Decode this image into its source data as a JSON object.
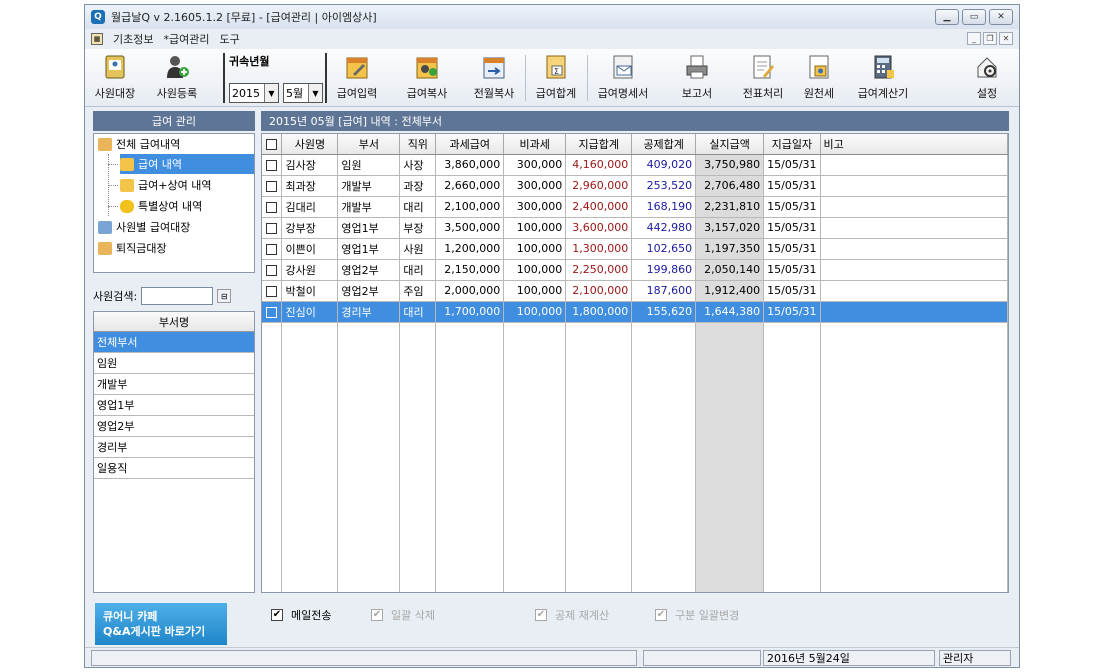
{
  "window": {
    "title": "월급날Q  v 2.1605.1.2 [무료] - [급여관리 | 아이엠상사]",
    "app_icon": "Q"
  },
  "menu": {
    "items": [
      "기초정보",
      "*급여관리",
      "도구"
    ]
  },
  "toolbar": {
    "employee_ledger": "사원대장",
    "employee_register": "사원등록",
    "period_label": "귀속년월",
    "year": "2015",
    "month": "5월",
    "payroll_input": "급여입력",
    "payroll_copy": "급여복사",
    "prev_month_copy": "전월복사",
    "payroll_total": "급여합계",
    "payslip": "급여명세서",
    "report": "보고서",
    "voucher": "전표처리",
    "withholding": "원천세",
    "calculator": "급여계산기",
    "settings": "설정"
  },
  "left_panel": {
    "header": "급여 관리",
    "tree": [
      "전체 급여내역",
      "급여 내역",
      "급여+상여 내역",
      "특별상여 내역",
      "사원별 급여대장",
      "퇴직금대장"
    ],
    "search_label": "사원검색:",
    "dept_header": "부서명",
    "departments": [
      "전체부서",
      "임원",
      "개발부",
      "영업1부",
      "영업2부",
      "경리부",
      "일용직"
    ]
  },
  "grid": {
    "title": "2015년 05월 [급여] 내역 : 전체부서",
    "columns": [
      "사원명",
      "부서",
      "직위",
      "과세급여",
      "비과세",
      "지급합계",
      "공제합계",
      "실지급액",
      "지급일자",
      "비고"
    ],
    "rows": [
      [
        "김사장",
        "임원",
        "사장",
        "3,860,000",
        "300,000",
        "4,160,000",
        "409,020",
        "3,750,980",
        "15/05/31",
        ""
      ],
      [
        "최과장",
        "개발부",
        "과장",
        "2,660,000",
        "300,000",
        "2,960,000",
        "253,520",
        "2,706,480",
        "15/05/31",
        ""
      ],
      [
        "김대리",
        "개발부",
        "대리",
        "2,100,000",
        "300,000",
        "2,400,000",
        "168,190",
        "2,231,810",
        "15/05/31",
        ""
      ],
      [
        "강부장",
        "영업1부",
        "부장",
        "3,500,000",
        "100,000",
        "3,600,000",
        "442,980",
        "3,157,020",
        "15/05/31",
        ""
      ],
      [
        "이쁜이",
        "영업1부",
        "사원",
        "1,200,000",
        "100,000",
        "1,300,000",
        "102,650",
        "1,197,350",
        "15/05/31",
        ""
      ],
      [
        "강사원",
        "영업2부",
        "대리",
        "2,150,000",
        "100,000",
        "2,250,000",
        "199,860",
        "2,050,140",
        "15/05/31",
        ""
      ],
      [
        "박철이",
        "영업2부",
        "주임",
        "2,000,000",
        "100,000",
        "2,100,000",
        "187,600",
        "1,912,400",
        "15/05/31",
        ""
      ],
      [
        "진심이",
        "경리부",
        "대리",
        "1,700,000",
        "100,000",
        "1,800,000",
        "155,620",
        "1,644,380",
        "15/05/31",
        ""
      ]
    ],
    "selected_row": 7
  },
  "bottom": {
    "banner_line1": "큐어니 카페",
    "banner_line2": "Q&A게시판 바로가기",
    "email_send": "메일전송",
    "bulk_delete": "일괄 삭제",
    "deduction_recalc": "공제 재계산",
    "category_bulk_change": "구분 일괄변경"
  },
  "status": {
    "date": "2016년 5월24일",
    "user": "관리자"
  },
  "colors": {
    "header_bg": "#5f7595",
    "selection": "#3f8ee0",
    "pay_total": "#a01818",
    "deduction": "#1a1aa0"
  }
}
